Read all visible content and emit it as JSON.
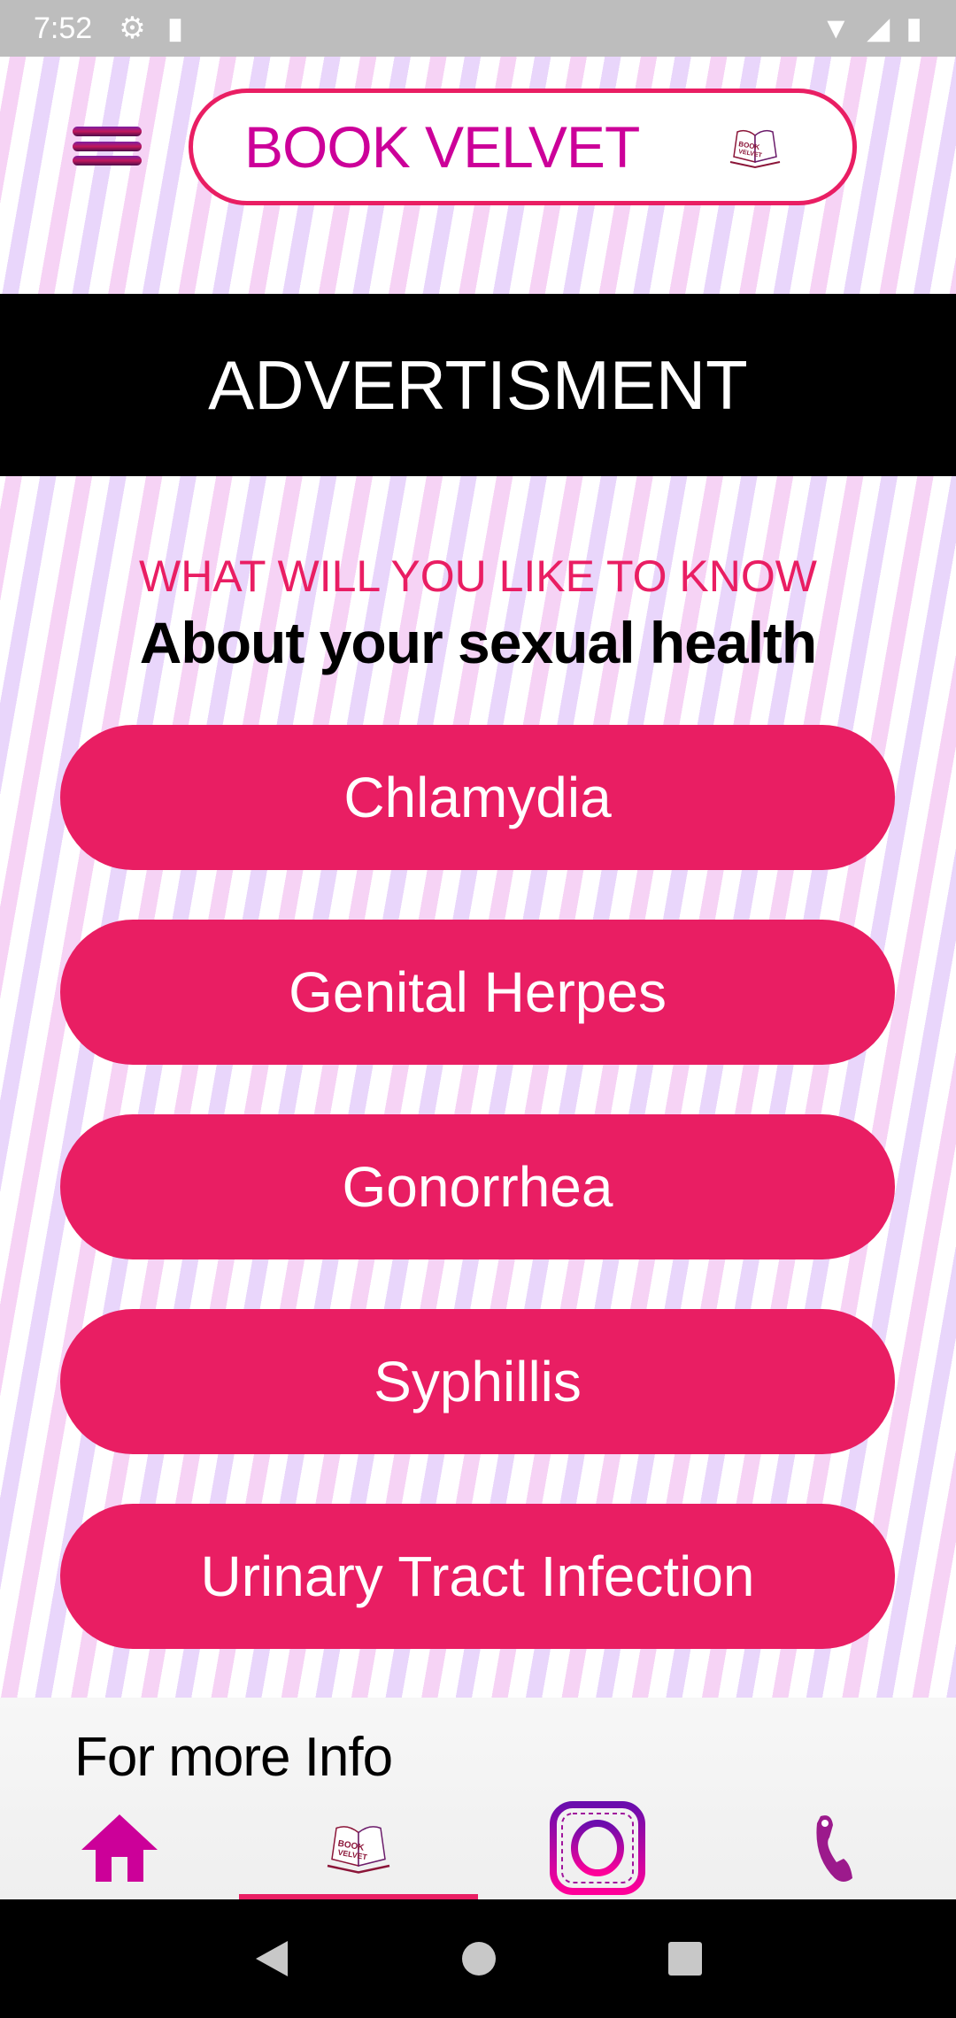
{
  "status": {
    "time": "7:52"
  },
  "header": {
    "title": "BOOK VELVET",
    "logo_text": "BOOK VELVET"
  },
  "ad": {
    "label": "ADVERTISMENT"
  },
  "main": {
    "question": "WHAT WILL YOU LIKE TO KNOW",
    "subtitle": "About your sexual health",
    "topics": [
      {
        "label": "Chlamydia"
      },
      {
        "label": "Genital Herpes"
      },
      {
        "label": "Gonorrhea"
      },
      {
        "label": "Syphillis"
      },
      {
        "label": "Urinary Tract Infection"
      }
    ]
  },
  "footer": {
    "title": "For more Info",
    "tabs": [
      "home-icon",
      "book-velvet-logo-icon",
      "instagram-icon",
      "phone-icon"
    ],
    "selected_tab": 1
  },
  "colors": {
    "accent": "#e91e63",
    "brand": "#cc0099",
    "ad_bg": "#000000"
  }
}
